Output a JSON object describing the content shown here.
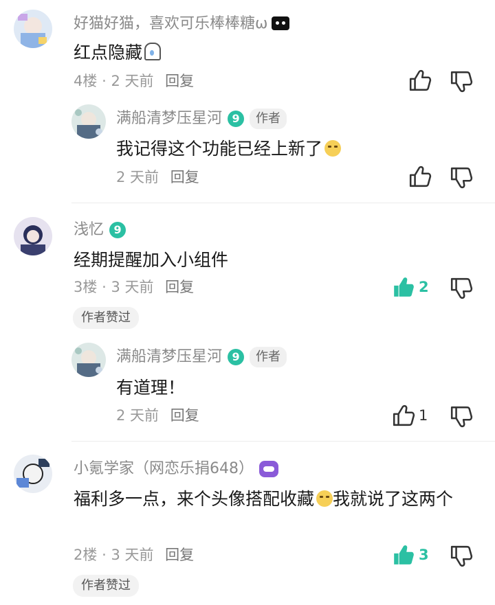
{
  "colors": {
    "accent": "#2bc0a3",
    "muted": "#999999",
    "badge_purple": "#8a5ad8"
  },
  "comments": [
    {
      "user": "好猫好猫，喜欢可乐棒棒糖ω",
      "text": "红点隐藏",
      "floor": "4楼",
      "sep": "·",
      "time": "2 天前",
      "reply_label": "回复",
      "reply": {
        "user": "满船清梦压星河",
        "level": "9",
        "author_tag": "作者",
        "text": "我记得这个功能已经上新了",
        "time": "2 天前",
        "reply_label": "回复"
      }
    },
    {
      "user": "浅忆",
      "level": "9",
      "text": "经期提醒加入小组件",
      "floor": "3楼",
      "sep": "·",
      "time": "3 天前",
      "reply_label": "回复",
      "likes": "2",
      "author_liked": "作者赞过",
      "reply": {
        "user": "满船清梦压星河",
        "level": "9",
        "author_tag": "作者",
        "text": "有道理！",
        "time": "2 天前",
        "reply_label": "回复",
        "likes": "1"
      }
    },
    {
      "user": "小氪学家（网恋乐捐648）",
      "text_part1": "福利多一点，来个头像搭配收藏",
      "text_part2": "我就说了这两个",
      "floor": "2楼",
      "sep": "·",
      "time": "3 天前",
      "reply_label": "回复",
      "likes": "3",
      "author_liked": "作者赞过"
    }
  ]
}
